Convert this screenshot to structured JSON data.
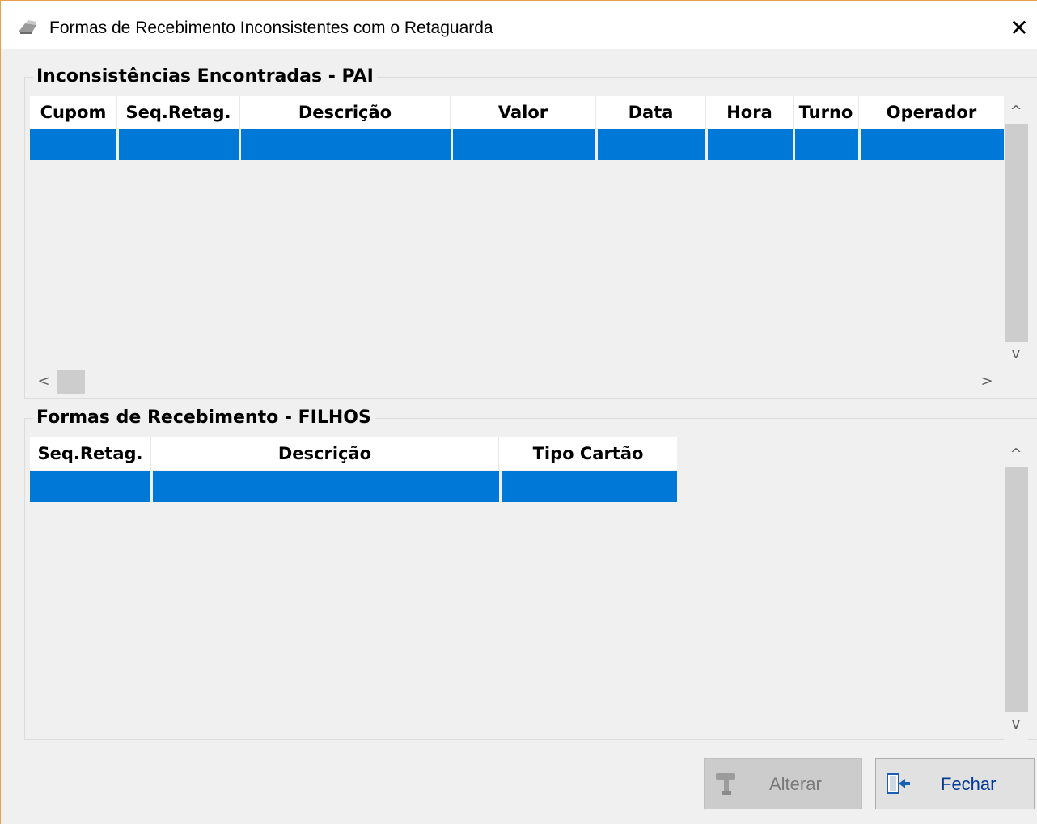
{
  "window": {
    "title": "Formas de Recebimento Inconsistentes com o Retaguarda",
    "close_glyph": "✕",
    "icon": "printer-icon"
  },
  "pai": {
    "title": "Inconsistências Encontradas - PAI",
    "columns": [
      "Cupom",
      "Seq.Retag.",
      "Descrição",
      "Valor",
      "Data",
      "Hora",
      "Turno",
      "Operador"
    ],
    "selected_row": [
      "",
      "",
      "",
      "",
      "",
      "",
      "",
      ""
    ]
  },
  "filhos": {
    "title": "Formas de Recebimento - FILHOS",
    "columns": [
      "Seq.Retag.",
      "Descrição",
      "Tipo Cartão"
    ],
    "selected_row": [
      "",
      "",
      ""
    ]
  },
  "scroll": {
    "up": "^",
    "down": "v",
    "left": "<",
    "right": ">"
  },
  "buttons": {
    "alterar": {
      "label": "Alterar",
      "icon": "hammer-icon",
      "enabled": false
    },
    "fechar": {
      "label": "Fechar",
      "icon": "exit-door-icon",
      "enabled": true
    }
  },
  "colors": {
    "selection": "#0078d7",
    "window_bg": "#f0f0f0",
    "button_text": "#003a9a"
  }
}
